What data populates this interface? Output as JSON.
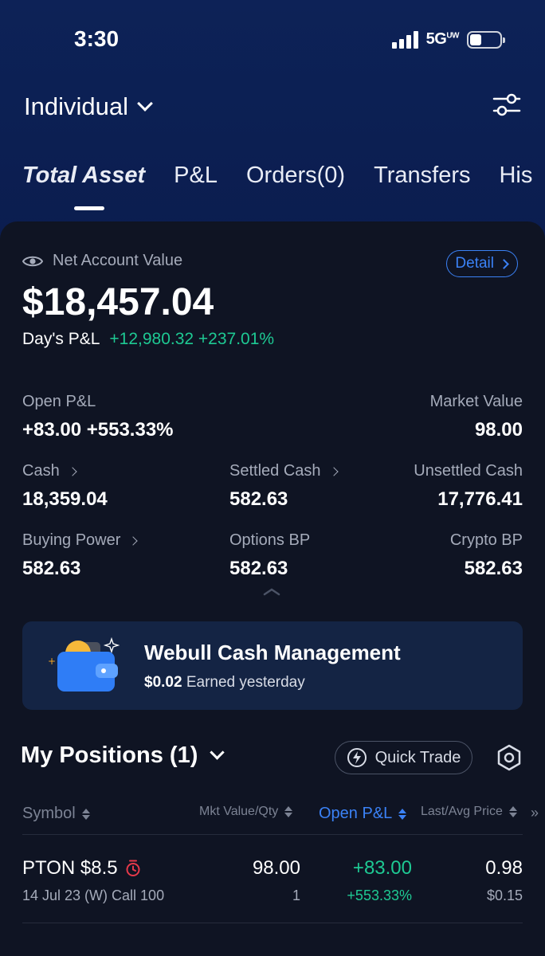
{
  "status_bar": {
    "time": "3:30",
    "network": "5G",
    "network_suffix": "UW"
  },
  "header": {
    "account_name": "Individual"
  },
  "tabs": [
    {
      "label": "Total Asset",
      "active": true
    },
    {
      "label": "P&L"
    },
    {
      "label": "Orders(0)"
    },
    {
      "label": "Transfers"
    },
    {
      "label": "His"
    }
  ],
  "summary": {
    "net_account_label": "Net Account Value",
    "detail_label": "Detail",
    "net_account_value": "$18,457.04",
    "days_pl_label": "Day's P&L",
    "days_pl_value": "+12,980.32",
    "days_pl_percent": "+237.01%"
  },
  "metrics": {
    "open_pl": {
      "label": "Open P&L",
      "value": "+83.00 +553.33%"
    },
    "market_value": {
      "label": "Market Value",
      "value": "98.00"
    },
    "cash": {
      "label": "Cash",
      "value": "18,359.04"
    },
    "settled_cash": {
      "label": "Settled Cash",
      "value": "582.63"
    },
    "unsettled_cash": {
      "label": "Unsettled Cash",
      "value": "17,776.41"
    },
    "buying_power": {
      "label": "Buying Power",
      "value": "582.63"
    },
    "options_bp": {
      "label": "Options BP",
      "value": "582.63"
    },
    "crypto_bp": {
      "label": "Crypto BP",
      "value": "582.63"
    }
  },
  "cash_management": {
    "title": "Webull Cash Management",
    "earned_amount": "$0.02",
    "earned_label": "Earned yesterday"
  },
  "positions": {
    "title": "My Positions (1)",
    "quick_trade_label": "Quick Trade",
    "columns": [
      "Symbol",
      "Mkt Value/Qty",
      "Open P&L",
      "Last/Avg Price"
    ],
    "rows": [
      {
        "symbol": "PTON $8.5",
        "contract": "14 Jul 23 (W) Call 100",
        "mkt_value": "98.00",
        "qty": "1",
        "open_pl": "+83.00",
        "open_pl_percent": "+553.33%",
        "last_price": "0.98",
        "avg_price": "$0.15"
      }
    ]
  },
  "colors": {
    "accent_blue": "#3b82f6",
    "gain_green": "#1ec993",
    "alert_red": "#e5394a",
    "header_navy": "#0c1a4a",
    "card_bg": "#0f1423"
  }
}
